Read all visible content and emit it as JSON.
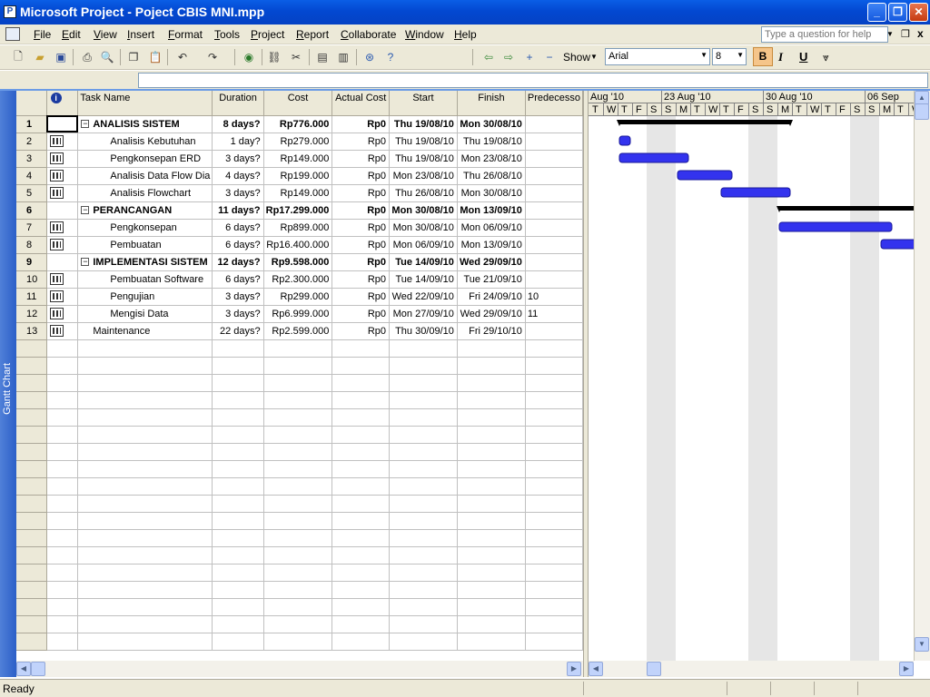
{
  "window": {
    "title": "Microsoft Project - Poject CBIS MNI.mpp"
  },
  "menu": [
    "File",
    "Edit",
    "View",
    "Insert",
    "Format",
    "Tools",
    "Project",
    "Report",
    "Collaborate",
    "Window",
    "Help"
  ],
  "help_placeholder": "Type a question for help",
  "toolbar": {
    "show_label": "Show",
    "font": "Arial",
    "size": "8",
    "bold": "B",
    "italic": "I",
    "underline": "U"
  },
  "view_bar_label": "Gantt Chart",
  "columns": [
    "Task Name",
    "Duration",
    "Cost",
    "Actual Cost",
    "Start",
    "Finish",
    "Predecesso"
  ],
  "tasks": [
    {
      "id": "1",
      "name": "ANALISIS SISTEM",
      "duration": "8 days?",
      "cost": "Rp776.000",
      "actual": "Rp0",
      "start": "Thu 19/08/10",
      "finish": "Mon 30/08/10",
      "pred": "",
      "summary": true,
      "level": 0
    },
    {
      "id": "2",
      "name": "Analisis Kebutuhan",
      "duration": "1 day?",
      "cost": "Rp279.000",
      "actual": "Rp0",
      "start": "Thu 19/08/10",
      "finish": "Thu 19/08/10",
      "pred": "",
      "summary": false,
      "level": 1
    },
    {
      "id": "3",
      "name": "Pengkonsepan ERD",
      "duration": "3 days?",
      "cost": "Rp149.000",
      "actual": "Rp0",
      "start": "Thu 19/08/10",
      "finish": "Mon 23/08/10",
      "pred": "",
      "summary": false,
      "level": 1
    },
    {
      "id": "4",
      "name": "Analisis Data Flow Dia",
      "duration": "4 days?",
      "cost": "Rp199.000",
      "actual": "Rp0",
      "start": "Mon 23/08/10",
      "finish": "Thu 26/08/10",
      "pred": "",
      "summary": false,
      "level": 1
    },
    {
      "id": "5",
      "name": "Analisis Flowchart",
      "duration": "3 days?",
      "cost": "Rp149.000",
      "actual": "Rp0",
      "start": "Thu 26/08/10",
      "finish": "Mon 30/08/10",
      "pred": "",
      "summary": false,
      "level": 1
    },
    {
      "id": "6",
      "name": "PERANCANGAN",
      "duration": "11 days?",
      "cost": "Rp17.299.000",
      "actual": "Rp0",
      "start": "Mon 30/08/10",
      "finish": "Mon 13/09/10",
      "pred": "",
      "summary": true,
      "level": 0
    },
    {
      "id": "7",
      "name": "Pengkonsepan",
      "duration": "6 days?",
      "cost": "Rp899.000",
      "actual": "Rp0",
      "start": "Mon 30/08/10",
      "finish": "Mon 06/09/10",
      "pred": "",
      "summary": false,
      "level": 1
    },
    {
      "id": "8",
      "name": "Pembuatan",
      "duration": "6 days?",
      "cost": "Rp16.400.000",
      "actual": "Rp0",
      "start": "Mon 06/09/10",
      "finish": "Mon 13/09/10",
      "pred": "",
      "summary": false,
      "level": 1
    },
    {
      "id": "9",
      "name": "IMPLEMENTASI SISTEM",
      "duration": "12 days?",
      "cost": "Rp9.598.000",
      "actual": "Rp0",
      "start": "Tue 14/09/10",
      "finish": "Wed 29/09/10",
      "pred": "",
      "summary": true,
      "level": 0
    },
    {
      "id": "10",
      "name": "Pembuatan Software",
      "duration": "6 days?",
      "cost": "Rp2.300.000",
      "actual": "Rp0",
      "start": "Tue 14/09/10",
      "finish": "Tue 21/09/10",
      "pred": "",
      "summary": false,
      "level": 1
    },
    {
      "id": "11",
      "name": "Pengujian",
      "duration": "3 days?",
      "cost": "Rp299.000",
      "actual": "Rp0",
      "start": "Wed 22/09/10",
      "finish": "Fri 24/09/10",
      "pred": "10",
      "summary": false,
      "level": 1
    },
    {
      "id": "12",
      "name": "Mengisi Data",
      "duration": "3 days?",
      "cost": "Rp6.999.000",
      "actual": "Rp0",
      "start": "Mon 27/09/10",
      "finish": "Wed 29/09/10",
      "pred": "11",
      "summary": false,
      "level": 1
    },
    {
      "id": "13",
      "name": "Maintenance",
      "duration": "22 days?",
      "cost": "Rp2.599.000",
      "actual": "Rp0",
      "start": "Thu 30/09/10",
      "finish": "Fri 29/10/10",
      "pred": "",
      "summary": false,
      "level": 0
    }
  ],
  "timescale": {
    "weeks": [
      "Aug '10",
      "23 Aug '10",
      "30 Aug '10",
      "06 Sep"
    ],
    "days": [
      "T",
      "W",
      "T",
      "F",
      "S",
      "S",
      "M",
      "T",
      "W",
      "T",
      "F",
      "S",
      "S",
      "M",
      "T",
      "W",
      "T",
      "F",
      "S",
      "S",
      "M",
      "T",
      "W"
    ]
  },
  "status": "Ready"
}
